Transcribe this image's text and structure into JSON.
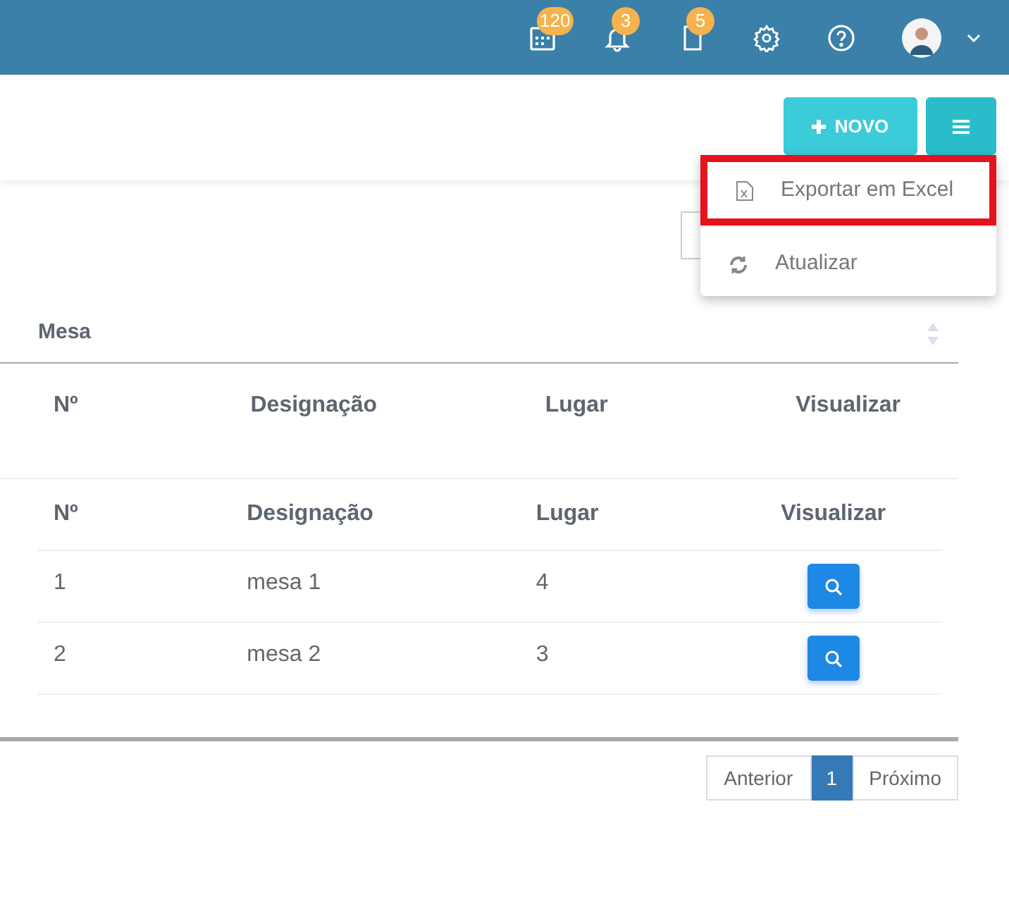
{
  "topbar": {
    "icons": [
      {
        "kind": "calendar",
        "badge": "120"
      },
      {
        "kind": "bell",
        "badge": "3"
      },
      {
        "kind": "document",
        "badge": "5"
      },
      {
        "kind": "settings"
      },
      {
        "kind": "help"
      },
      {
        "kind": "avatar"
      }
    ]
  },
  "toolbar": {
    "new_button": "NOVO"
  },
  "menu": {
    "items": [
      {
        "kind": "excel",
        "label": "Exportar em Excel",
        "highlighted": true
      },
      {
        "kind": "refresh",
        "label": "Atualizar",
        "highlighted": false
      }
    ]
  },
  "group_header": "Mesa",
  "group_columns": [
    "Nº",
    "Designação",
    "Lugar",
    "Visualizar"
  ],
  "table": {
    "columns": [
      "Nº",
      "Designação",
      "Lugar",
      "Visualizar"
    ],
    "rows": [
      {
        "no": "1",
        "designation": "mesa 1",
        "place": "4"
      },
      {
        "no": "2",
        "designation": "mesa 2",
        "place": "3"
      }
    ]
  },
  "pagination": {
    "previous": "Anterior",
    "pages": [
      {
        "label": "1",
        "selected": true
      }
    ],
    "next": "Próximo"
  }
}
